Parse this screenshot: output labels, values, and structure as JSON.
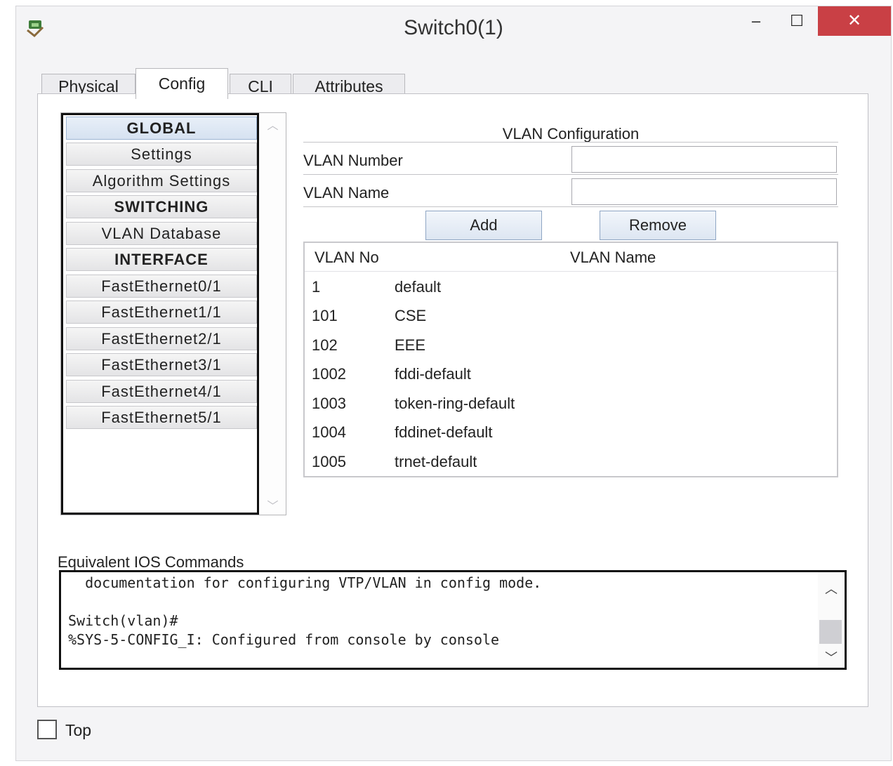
{
  "window": {
    "title": "Switch0(1)",
    "icons": {
      "app": "switch-app-icon",
      "minimize": "minimize-icon",
      "maximize": "maximize-icon",
      "close": "close-icon"
    },
    "minimize_glyph": "–",
    "maximize_glyph": "☐",
    "close_glyph": "✕",
    "close_color": "#c94045"
  },
  "tabs": [
    {
      "label": "Physical"
    },
    {
      "label": "Config",
      "active": true
    },
    {
      "label": "CLI"
    },
    {
      "label": "Attributes"
    }
  ],
  "nav": {
    "items": [
      {
        "label": "GLOBAL",
        "header": true,
        "selected": true
      },
      {
        "label": "Settings"
      },
      {
        "label": "Algorithm Settings"
      },
      {
        "label": "SWITCHING",
        "header": true
      },
      {
        "label": "VLAN Database"
      },
      {
        "label": "INTERFACE",
        "header": true
      },
      {
        "label": "FastEthernet0/1"
      },
      {
        "label": "FastEthernet1/1"
      },
      {
        "label": "FastEthernet2/1"
      },
      {
        "label": "FastEthernet3/1"
      },
      {
        "label": "FastEthernet4/1"
      },
      {
        "label": "FastEthernet5/1"
      }
    ],
    "scroll_up_glyph": "︿",
    "scroll_down_glyph": "﹀"
  },
  "vlan_config": {
    "title": "VLAN Configuration",
    "number_label": "VLAN Number",
    "number_value": "",
    "name_label": "VLAN Name",
    "name_value": "",
    "add_label": "Add",
    "remove_label": "Remove",
    "table": {
      "headers": [
        "VLAN No",
        "VLAN Name"
      ],
      "rows": [
        [
          "1",
          "default"
        ],
        [
          "101",
          "CSE"
        ],
        [
          "102",
          "EEE"
        ],
        [
          "1002",
          "fddi-default"
        ],
        [
          "1003",
          "token-ring-default"
        ],
        [
          "1004",
          "fddinet-default"
        ],
        [
          "1005",
          "trnet-default"
        ]
      ]
    }
  },
  "ios": {
    "label": "Equivalent IOS Commands",
    "lines": [
      "  documentation for configuring VTP/VLAN in config mode.",
      "",
      "Switch(vlan)#",
      "%SYS-5-CONFIG_I: Configured from console by console"
    ],
    "scroll_up_glyph": "︿",
    "scroll_down_glyph": "﹀"
  },
  "footer": {
    "top_label": "Top",
    "top_checked": false
  }
}
